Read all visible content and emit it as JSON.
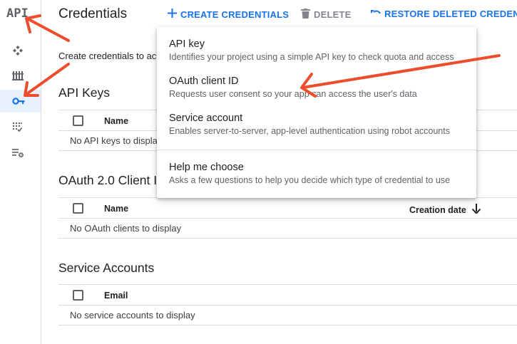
{
  "sidebar": {
    "logo": "API",
    "items": [
      {
        "icon": "dashboard-icon"
      },
      {
        "icon": "library-icon"
      },
      {
        "icon": "key-icon",
        "active": true
      },
      {
        "icon": "oauth-consent-icon"
      },
      {
        "icon": "settings-list-icon"
      }
    ]
  },
  "header": {
    "title": "Credentials",
    "create_label": "CREATE CREDENTIALS",
    "delete_label": "DELETE",
    "restore_label": "RESTORE DELETED CREDENTIA"
  },
  "description": "Create credentials to acc",
  "sections": {
    "api_keys": {
      "title": "API Keys",
      "columns": [
        "Name"
      ],
      "empty": "No API keys to displa"
    },
    "oauth": {
      "title": "OAuth 2.0 Client I",
      "columns": [
        "Name",
        "Creation date"
      ],
      "empty": "No OAuth clients to display"
    },
    "service_accounts": {
      "title": "Service Accounts",
      "columns": [
        "Email"
      ],
      "empty": "No service accounts to display"
    }
  },
  "menu": {
    "items": [
      {
        "label": "API key",
        "sub": "Identifies your project using a simple API key to check quota and access"
      },
      {
        "label": "OAuth client ID",
        "sub": "Requests user consent so your app can access the user's data"
      },
      {
        "label": "Service account",
        "sub": "Enables server-to-server, app-level authentication using robot accounts"
      },
      {
        "label": "Help me choose",
        "sub": "Asks a few questions to help you decide which type of credential to use"
      }
    ]
  },
  "colors": {
    "accent": "#1a73e8",
    "annotation": "#ee4d2d",
    "active_bg": "#e8f0fe"
  }
}
